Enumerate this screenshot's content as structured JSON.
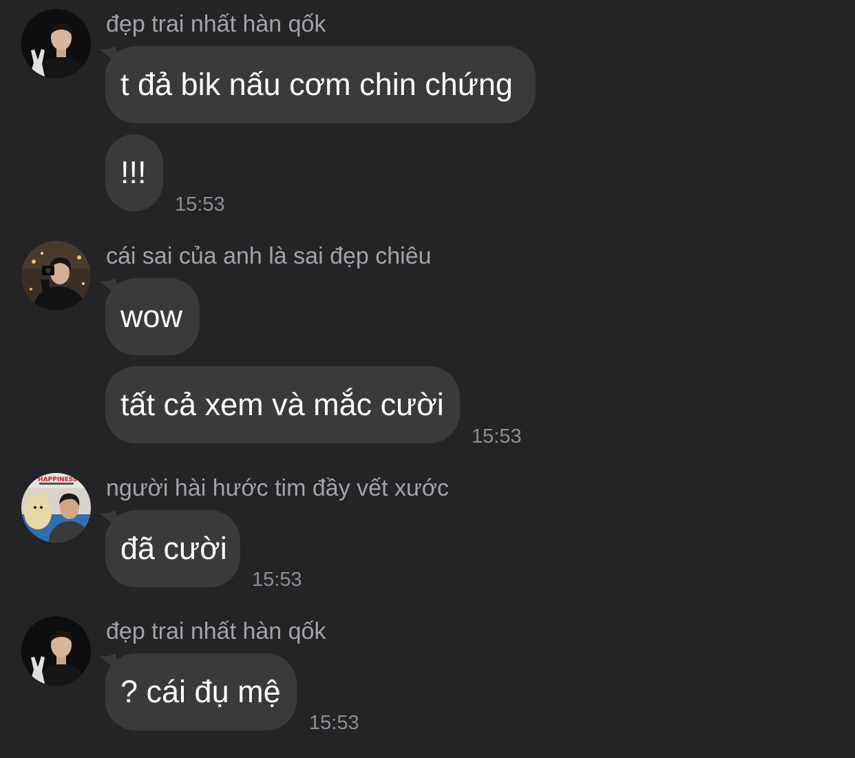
{
  "groups": [
    {
      "sender": "đẹp trai nhất hàn qốk",
      "avatar": "avatar-man-peace-sign",
      "messages": [
        {
          "text": "t đả bik nấu cơm chin chứng"
        },
        {
          "text": "!!!",
          "time": "15:53"
        }
      ]
    },
    {
      "sender": "cái sai của anh là sai đẹp chiêu",
      "avatar": "avatar-man-with-camera",
      "messages": [
        {
          "text": "wow"
        },
        {
          "text": "tất cả xem và mắc cười",
          "time": "15:53"
        }
      ]
    },
    {
      "sender": "người hài hước tim đầy vết xước",
      "avatar": "avatar-man-with-teddy-bear",
      "avatar_sign_text": "HAPPINESS",
      "messages": [
        {
          "text": "đã cười",
          "time": "15:53"
        }
      ]
    },
    {
      "sender": "đẹp trai nhất hàn qốk",
      "avatar": "avatar-man-peace-sign",
      "messages": [
        {
          "text": "? cái đụ mệ",
          "time": "15:53"
        }
      ]
    }
  ],
  "colors": {
    "background": "#242426",
    "bubble": "#3a3a3c",
    "sender_name": "#a3a3a8",
    "timestamp": "#8e8e93",
    "message_text": "#ffffff"
  }
}
